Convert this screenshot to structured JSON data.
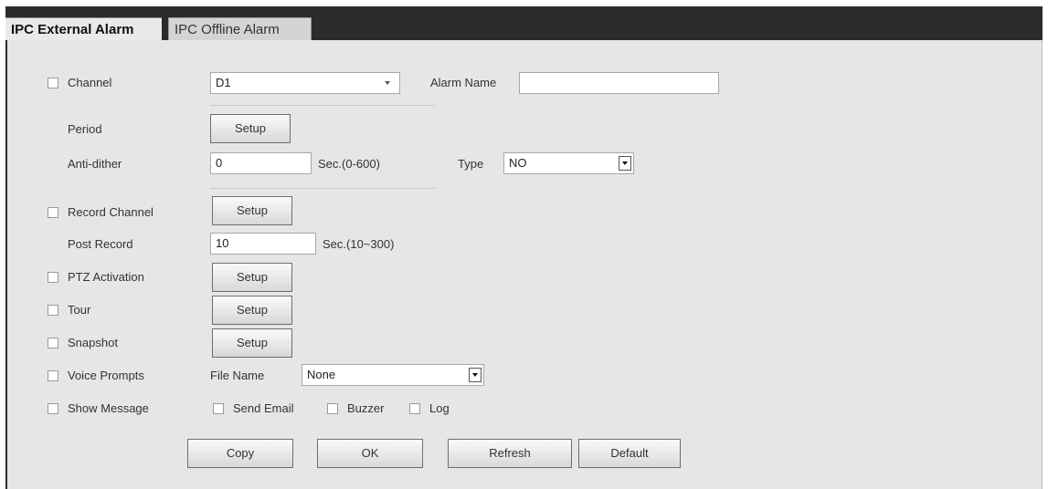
{
  "tabs": [
    {
      "label": "IPC External Alarm",
      "active": true
    },
    {
      "label": "IPC Offline Alarm",
      "active": false
    }
  ],
  "form": {
    "channel": {
      "label": "Channel",
      "value": "D1"
    },
    "alarm_name": {
      "label": "Alarm Name",
      "value": ""
    },
    "period": {
      "label": "Period",
      "button": "Setup"
    },
    "anti_dither": {
      "label": "Anti-dither",
      "value": "0",
      "unit": "Sec.(0-600)"
    },
    "type": {
      "label": "Type",
      "value": "NO"
    },
    "record_channel": {
      "label": "Record Channel",
      "button": "Setup"
    },
    "post_record": {
      "label": "Post Record",
      "value": "10",
      "unit": "Sec.(10~300)"
    },
    "ptz_activation": {
      "label": "PTZ Activation",
      "button": "Setup"
    },
    "tour": {
      "label": "Tour",
      "button": "Setup"
    },
    "snapshot": {
      "label": "Snapshot",
      "button": "Setup"
    },
    "voice_prompts": {
      "label": "Voice Prompts",
      "file_name_label": "File Name",
      "file_name_value": "None"
    },
    "show_message": {
      "label": "Show Message"
    },
    "send_email": {
      "label": "Send Email"
    },
    "buzzer": {
      "label": "Buzzer"
    },
    "log": {
      "label": "Log"
    }
  },
  "actions": {
    "copy": "Copy",
    "ok": "OK",
    "refresh": "Refresh",
    "default": "Default"
  }
}
